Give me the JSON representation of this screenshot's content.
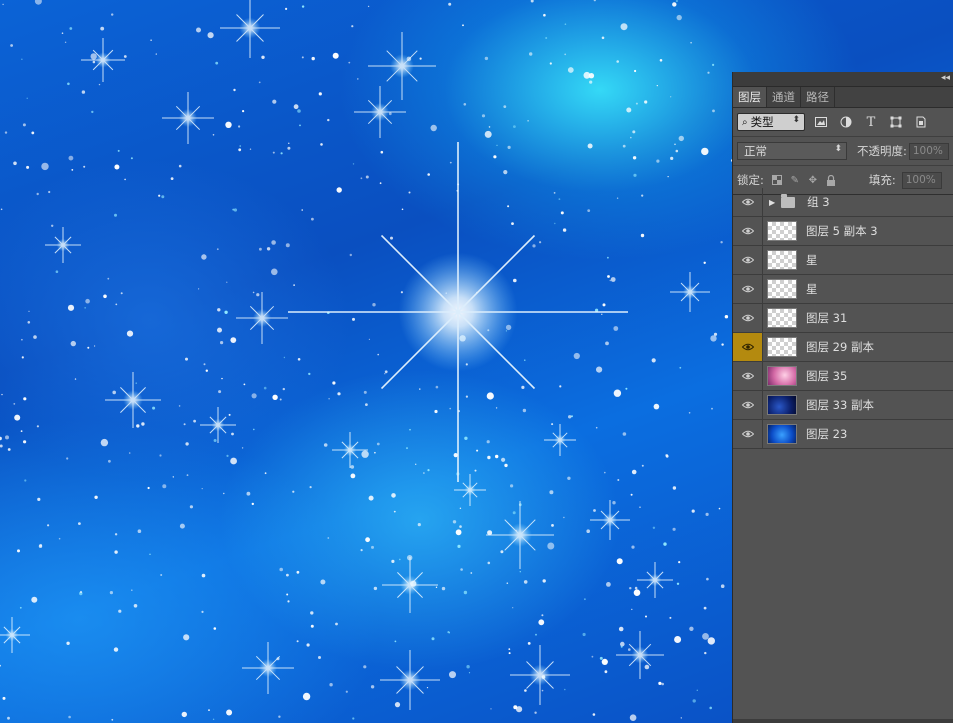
{
  "panel": {
    "tabs": [
      {
        "label": "图层",
        "active": true
      },
      {
        "label": "通道",
        "active": false
      },
      {
        "label": "路径",
        "active": false
      }
    ],
    "filter": {
      "value": "类型"
    },
    "blend_mode": {
      "value": "正常"
    },
    "opacity": {
      "label": "不透明度:",
      "value": "100%"
    },
    "lock": {
      "label": "锁定:"
    },
    "fill": {
      "label": "填充:",
      "value": "100%"
    },
    "layers": [
      {
        "name": "组 3",
        "kind": "group",
        "selected": false
      },
      {
        "name": "图层 5 副本 3",
        "kind": "empty",
        "selected": false
      },
      {
        "name": "星",
        "kind": "empty",
        "selected": false
      },
      {
        "name": "星",
        "kind": "empty",
        "selected": false
      },
      {
        "name": "图层 31",
        "kind": "empty",
        "selected": false
      },
      {
        "name": "图层 29 副本",
        "kind": "empty",
        "selected": true
      },
      {
        "name": "图层 35",
        "kind": "pink",
        "selected": false
      },
      {
        "name": "图层 33 副本",
        "kind": "dark",
        "selected": false
      },
      {
        "name": "图层 23",
        "kind": "blue",
        "selected": false
      }
    ]
  },
  "colors": {
    "panel_bg": "#535353",
    "selected_eye": "#b48a0f",
    "canvas_blue": "#0a55c8"
  },
  "icons": [
    "filter-search-icon",
    "image-filter-icon",
    "adjustment-filter-icon",
    "type-filter-icon",
    "shape-filter-icon",
    "smart-object-filter-icon",
    "lock-transparent-icon",
    "lock-paint-icon",
    "lock-move-icon",
    "lock-all-icon",
    "eye-icon",
    "folder-icon",
    "expand-arrow-icon"
  ]
}
